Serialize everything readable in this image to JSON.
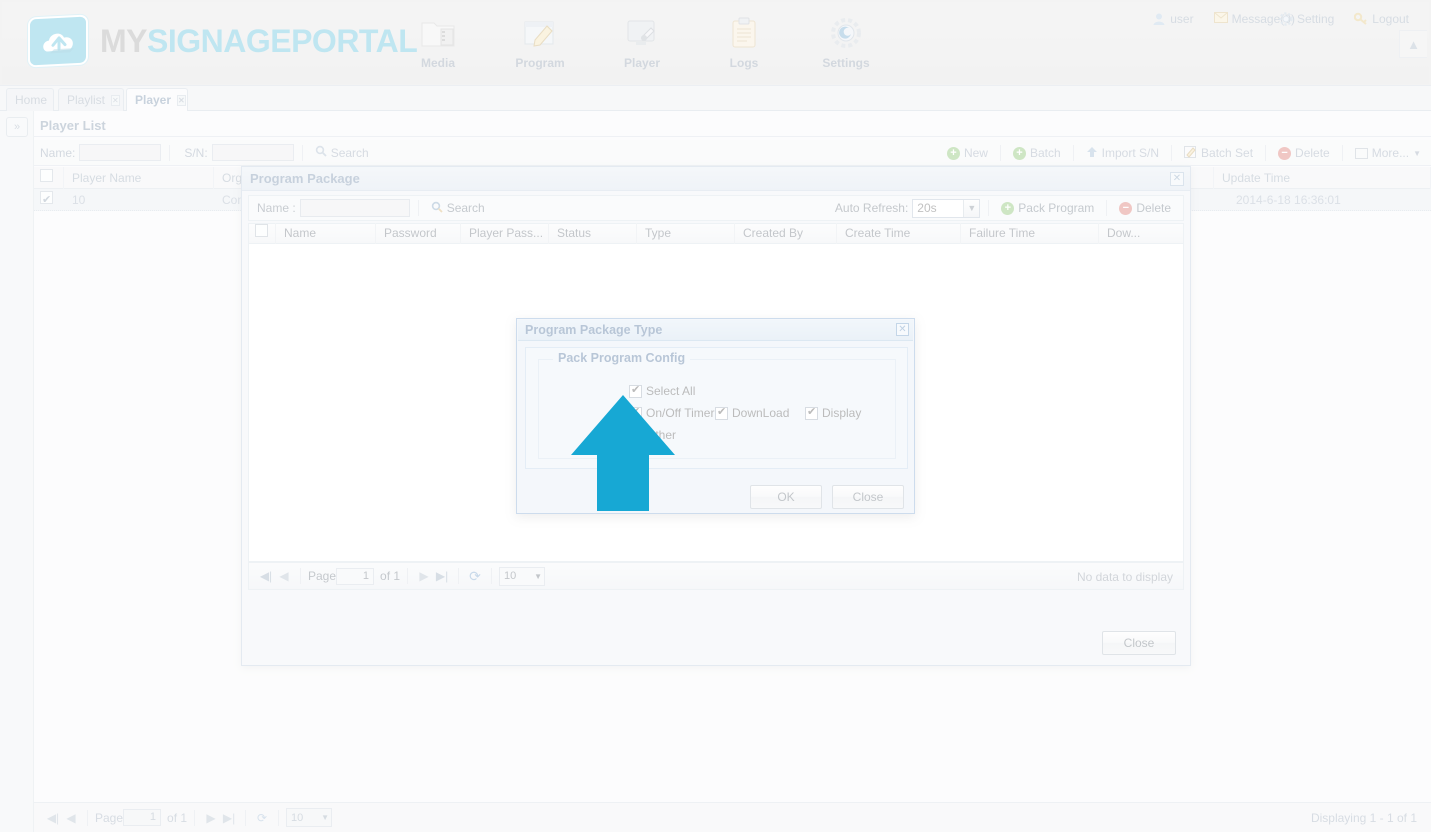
{
  "header": {
    "logo": {
      "word1": "MY",
      "word2": "SIGNAGE",
      "word3": "PORTAL",
      "icon": "cloud-upload-icon"
    },
    "nav": [
      {
        "label": "Media",
        "icon": "media-folder-icon"
      },
      {
        "label": "Program",
        "icon": "program-edit-icon"
      },
      {
        "label": "Player",
        "icon": "player-screen-icon"
      },
      {
        "label": "Logs",
        "icon": "logs-clipboard-icon"
      },
      {
        "label": "Settings",
        "icon": "settings-gear-icon"
      }
    ],
    "usermenu": [
      {
        "label": "user",
        "icon": "user-icon"
      },
      {
        "label": "Message(0)",
        "icon": "envelope-icon"
      },
      {
        "label": "Setting",
        "icon": "gear-icon"
      },
      {
        "label": "Logout",
        "icon": "key-icon"
      }
    ],
    "collapse_icon": "chevron-up-icon"
  },
  "tabs": [
    {
      "label": "Home",
      "closable": false,
      "active": false
    },
    {
      "label": "Playlist",
      "closable": true,
      "active": false
    },
    {
      "label": "Player",
      "closable": true,
      "active": true
    }
  ],
  "rail": {
    "expand_icon": "double-chevron-right-icon"
  },
  "player_list": {
    "title": "Player List",
    "toolbar": {
      "name_label": "Name:",
      "name_value": "",
      "sn_label": "S/N:",
      "sn_value": "",
      "search_label": "Search",
      "search_icon": "magnifier-icon",
      "buttons": [
        {
          "label": "New",
          "icon": "plus-circle-green-icon"
        },
        {
          "label": "Batch",
          "icon": "plus-circle-green-icon"
        },
        {
          "label": "Import S/N",
          "icon": "upload-arrow-icon"
        },
        {
          "label": "Batch Set",
          "icon": "pencil-note-icon"
        },
        {
          "label": "Delete",
          "icon": "minus-circle-red-icon"
        },
        {
          "label": "More...",
          "icon": "grid-list-icon"
        }
      ]
    },
    "columns": [
      "Player Name",
      "Organ",
      "Update Time"
    ],
    "rows": [
      {
        "checked": true,
        "player_name": "10",
        "organization": "Comp",
        "update_time": "2014-6-18 16:36:01"
      }
    ],
    "footer": {
      "page_label": "Page",
      "page_value": "1",
      "of_label": "of 1",
      "page_size": "10",
      "status": "Displaying 1 - 1 of 1",
      "first_icon": "first-page-icon",
      "prev_icon": "prev-page-icon",
      "next_icon": "next-page-icon",
      "last_icon": "last-page-icon",
      "refresh_icon": "refresh-icon"
    }
  },
  "program_package": {
    "title": "Program Package",
    "close_icon": "close-x-icon",
    "toolbar": {
      "name_label": "Name :",
      "name_value": "",
      "search_label": "Search",
      "search_icon": "magnifier-icon",
      "auto_refresh_label": "Auto Refresh:",
      "auto_refresh_value": "20s",
      "auto_refresh_options": [
        "20s"
      ],
      "pack_label": "Pack Program",
      "pack_icon": "plus-circle-green-icon",
      "delete_label": "Delete",
      "delete_icon": "minus-circle-red-icon"
    },
    "columns": [
      "Name",
      "Password",
      "Player Pass...",
      "Status",
      "Type",
      "Created By",
      "Create Time",
      "Failure Time",
      "Dow..."
    ],
    "rows": [],
    "grid_footer": {
      "page_label": "Page",
      "page_value": "1",
      "of_label": "of 1",
      "page_size": "10",
      "no_data": "No data to display",
      "first_icon": "first-page-icon",
      "prev_icon": "prev-page-icon",
      "next_icon": "next-page-icon",
      "last_icon": "last-page-icon",
      "refresh_icon": "refresh-icon"
    },
    "close_button": "Close"
  },
  "package_type_dialog": {
    "title": "Program Package Type",
    "close_icon": "close-x-icon",
    "legend": "Pack Program Config",
    "options": [
      {
        "label": "Select All",
        "checked": true
      },
      {
        "label": "On/Off Timer",
        "checked": true
      },
      {
        "label": "DownLoad",
        "checked": true
      },
      {
        "label": "Display",
        "checked": true
      },
      {
        "label": "Other",
        "checked": true
      }
    ],
    "ok_button": "OK",
    "close_button": "Close"
  },
  "cursor_overlay": {
    "icon": "big-up-arrow-cursor",
    "color": "#17a8d4"
  },
  "colors": {
    "brand_cyan": "#2fafd4",
    "title_blue": "#17457c",
    "dialog_bg": "#dbe8f4",
    "green": "#5fae3e",
    "red": "#d04a40"
  }
}
